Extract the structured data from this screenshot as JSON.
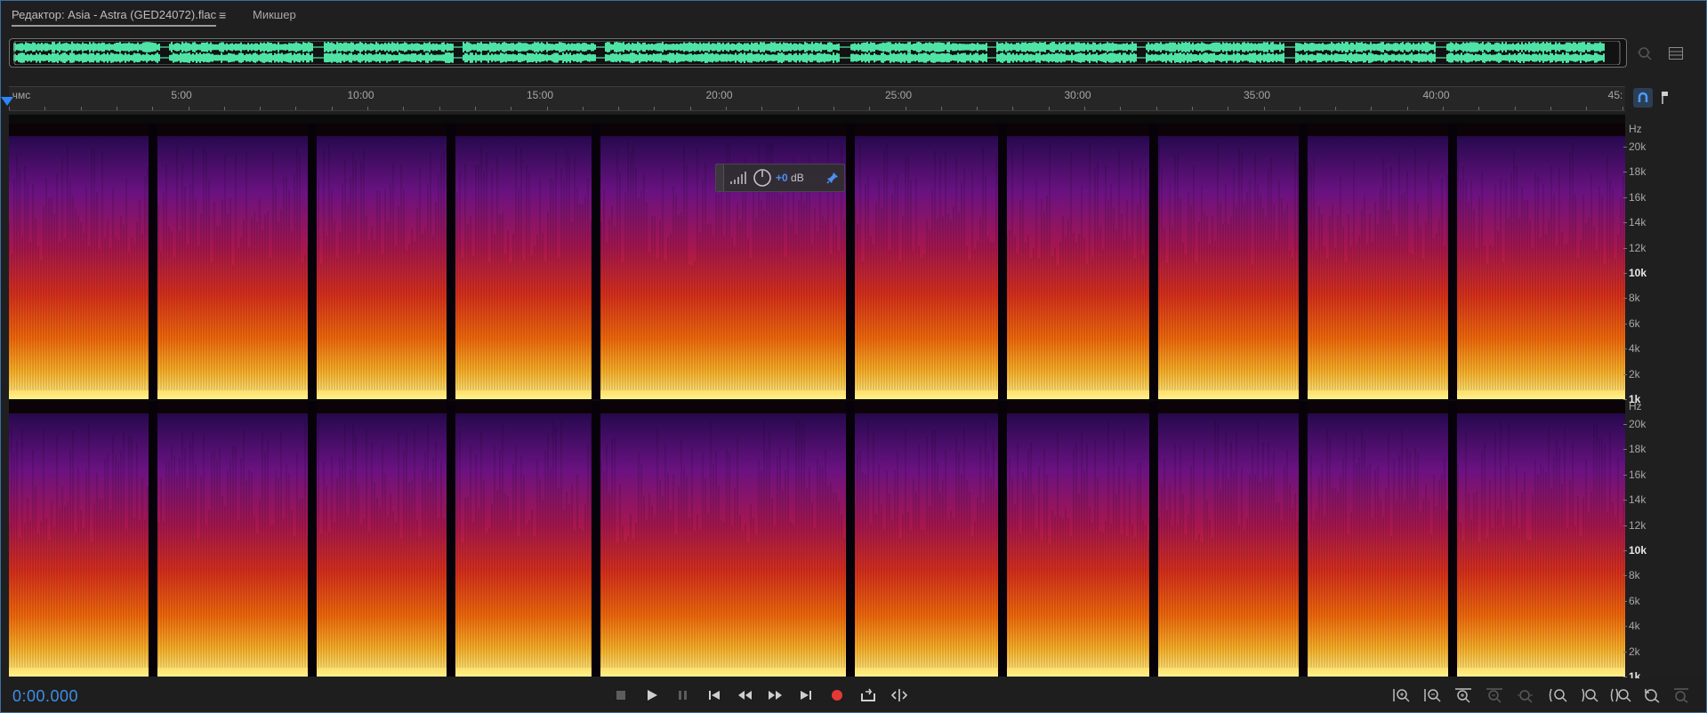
{
  "tabs": {
    "editor_label": "Редактор: Asia - Astra (GED24072).flac",
    "mixer_label": "Микшер",
    "menu_icon": "hamburger-icon"
  },
  "ruler": {
    "unit_label": "чмс",
    "ticks": [
      "5:00",
      "10:00",
      "15:00",
      "20:00",
      "25:00",
      "30:00",
      "35:00",
      "40:00",
      "45:"
    ]
  },
  "frequency_scale": {
    "unit": "Hz",
    "labels": [
      "20k",
      "18k",
      "16k",
      "14k",
      "12k",
      "10k",
      "8k",
      "6k",
      "4k",
      "2k",
      "1k"
    ]
  },
  "hud": {
    "gain_value": "+0",
    "gain_unit": " dB"
  },
  "transport": {
    "time": "0:00.000"
  },
  "colors": {
    "accent": "#2d86ff",
    "waveform": "#4fe3a6",
    "record": "#e53935",
    "timecode": "#3f8ee8"
  }
}
